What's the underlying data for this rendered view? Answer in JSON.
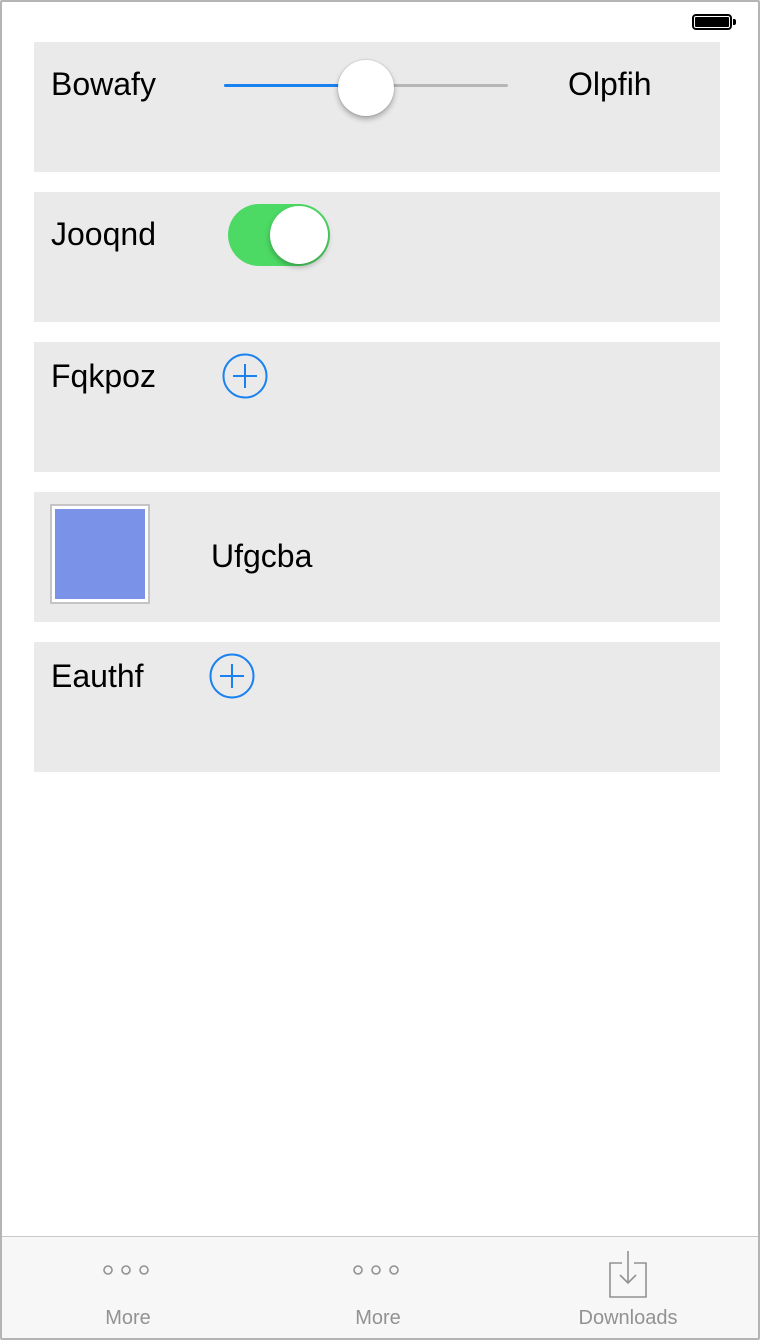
{
  "status_bar": {
    "battery_icon": "battery-full-icon"
  },
  "rows": {
    "slider_row": {
      "label": "Bowafy",
      "value_label": "Olpfih",
      "slider_value": 0.5,
      "accent": "#1a82f0"
    },
    "toggle_row": {
      "label": "Jooqnd",
      "toggle_on": true,
      "color": "#4cd964"
    },
    "add_row_1": {
      "label": "Fqkpoz",
      "icon": "plus-circle-icon",
      "color": "#1a82f0"
    },
    "color_row": {
      "label": "Ufgcba",
      "swatch_color": "#7a93e8"
    },
    "add_row_2": {
      "label": "Eauthf",
      "icon": "plus-circle-icon",
      "color": "#1a82f0"
    }
  },
  "tab_bar": {
    "tabs": [
      {
        "label": "More",
        "icon": "more-dots-icon"
      },
      {
        "label": "More",
        "icon": "more-dots-icon"
      },
      {
        "label": "Downloads",
        "icon": "downloads-icon"
      }
    ]
  }
}
